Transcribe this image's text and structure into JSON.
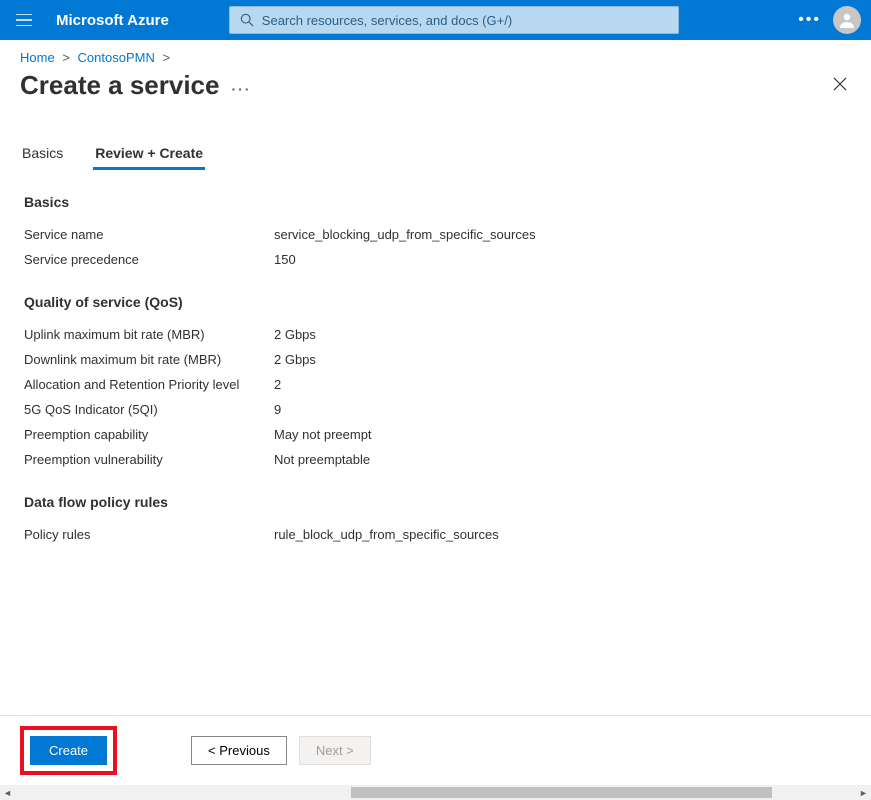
{
  "topbar": {
    "brand": "Microsoft Azure",
    "search_placeholder": "Search resources, services, and docs (G+/)"
  },
  "breadcrumb": {
    "items": [
      "Home",
      "ContosoPMN"
    ]
  },
  "page": {
    "title": "Create a service"
  },
  "tabs": {
    "basics": "Basics",
    "review_create": "Review + Create"
  },
  "sections": {
    "basics": {
      "title": "Basics",
      "service_name_label": "Service name",
      "service_name_value": "service_blocking_udp_from_specific_sources",
      "service_precedence_label": "Service precedence",
      "service_precedence_value": "150"
    },
    "qos": {
      "title": "Quality of service (QoS)",
      "uplink_mbr_label": "Uplink maximum bit rate (MBR)",
      "uplink_mbr_value": "2 Gbps",
      "downlink_mbr_label": "Downlink maximum bit rate (MBR)",
      "downlink_mbr_value": "2 Gbps",
      "arp_label": "Allocation and Retention Priority level",
      "arp_value": "2",
      "fiveqi_label": "5G QoS Indicator (5QI)",
      "fiveqi_value": "9",
      "preempt_cap_label": "Preemption capability",
      "preempt_cap_value": "May not preempt",
      "preempt_vuln_label": "Preemption vulnerability",
      "preempt_vuln_value": "Not preemptable"
    },
    "rules": {
      "title": "Data flow policy rules",
      "policy_rules_label": "Policy rules",
      "policy_rules_value": "rule_block_udp_from_specific_sources"
    }
  },
  "footer": {
    "create": "Create",
    "previous": "< Previous",
    "next": "Next >"
  }
}
